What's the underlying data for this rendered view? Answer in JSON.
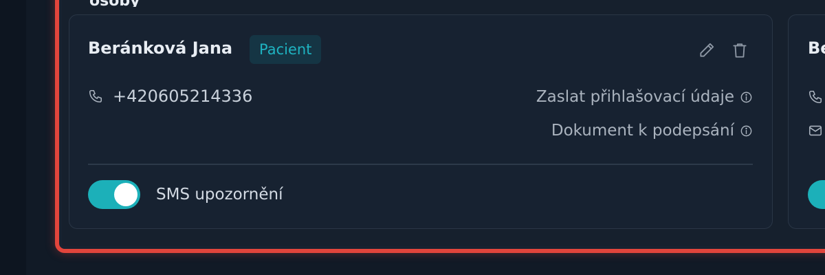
{
  "section": {
    "title": "Kontaktní osoby"
  },
  "card": {
    "name": "Beránková Jana",
    "badge": "Pacient",
    "phone": "+420605214336",
    "actions": [
      {
        "label": "Zaslat přihlašovací údaje",
        "icon": "info-icon"
      },
      {
        "label": "Dokument k podepsání",
        "icon": "info-icon"
      }
    ],
    "sms_toggle": {
      "label": "SMS upozornění",
      "enabled": true
    }
  },
  "next_card": {
    "name_partial": "Be"
  },
  "icons": {
    "edit": "pencil-icon",
    "delete": "trash-icon",
    "phone": "phone-icon",
    "mail": "mail-icon"
  },
  "colors": {
    "accent": "#1cb0b9",
    "badge_text": "#1fb3c1",
    "highlight": "#e2453c",
    "card_bg": "#172231"
  }
}
